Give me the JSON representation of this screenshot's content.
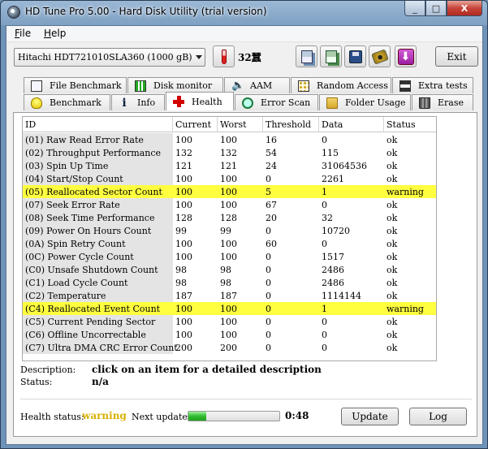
{
  "window": {
    "title": "HD Tune Pro 5.00 - Hard Disk Utility (trial version)",
    "minimize_glyph": "_",
    "maximize_glyph": "□",
    "close_glyph": "X"
  },
  "menu": {
    "items": [
      {
        "label": "File",
        "accel": "F",
        "rest": "ile"
      },
      {
        "label": "Help",
        "accel": "H",
        "rest": "elp"
      }
    ]
  },
  "toolbar": {
    "drive": "Hitachi HDT721010SLA360 (1000 gB)",
    "temperature": "32°C",
    "temperature_display": "32蠶",
    "icons": [
      "copy-text-icon",
      "copy-screenshot-icon",
      "save-icon",
      "options-icon",
      "download-icon"
    ],
    "exit_label": "Exit"
  },
  "tabs": {
    "row1": [
      {
        "label": "File Benchmark",
        "icon": "file-benchmark-icon"
      },
      {
        "label": "Disk monitor",
        "icon": "disk-monitor-icon"
      },
      {
        "label": "AAM",
        "icon": "speaker-icon"
      },
      {
        "label": "Random Access",
        "icon": "random-access-icon"
      },
      {
        "label": "Extra tests",
        "icon": "extra-tests-icon"
      }
    ],
    "row2": [
      {
        "label": "Benchmark",
        "icon": "lightbulb-icon"
      },
      {
        "label": "Info",
        "icon": "info-icon"
      },
      {
        "label": "Health",
        "icon": "health-cross-icon",
        "active": true
      },
      {
        "label": "Error Scan",
        "icon": "magnifier-icon"
      },
      {
        "label": "Folder Usage",
        "icon": "folder-icon"
      },
      {
        "label": "Erase",
        "icon": "trash-icon"
      }
    ]
  },
  "smart_table": {
    "columns": [
      "ID",
      "Current",
      "Worst",
      "Threshold",
      "Data",
      "Status"
    ],
    "rows": [
      {
        "id": "(01) Raw Read Error Rate",
        "current": "100",
        "worst": "100",
        "threshold": "16",
        "data": "0",
        "status": "ok"
      },
      {
        "id": "(02) Throughput Performance",
        "current": "132",
        "worst": "132",
        "threshold": "54",
        "data": "115",
        "status": "ok"
      },
      {
        "id": "(03) Spin Up Time",
        "current": "121",
        "worst": "121",
        "threshold": "24",
        "data": "31064536",
        "status": "ok"
      },
      {
        "id": "(04) Start/Stop Count",
        "current": "100",
        "worst": "100",
        "threshold": "0",
        "data": "2261",
        "status": "ok"
      },
      {
        "id": "(05) Reallocated Sector Count",
        "current": "100",
        "worst": "100",
        "threshold": "5",
        "data": "1",
        "status": "warning"
      },
      {
        "id": "(07) Seek Error Rate",
        "current": "100",
        "worst": "100",
        "threshold": "67",
        "data": "0",
        "status": "ok"
      },
      {
        "id": "(08) Seek Time Performance",
        "current": "128",
        "worst": "128",
        "threshold": "20",
        "data": "32",
        "status": "ok"
      },
      {
        "id": "(09) Power On Hours Count",
        "current": "99",
        "worst": "99",
        "threshold": "0",
        "data": "10720",
        "status": "ok"
      },
      {
        "id": "(0A) Spin Retry Count",
        "current": "100",
        "worst": "100",
        "threshold": "60",
        "data": "0",
        "status": "ok"
      },
      {
        "id": "(0C) Power Cycle Count",
        "current": "100",
        "worst": "100",
        "threshold": "0",
        "data": "1517",
        "status": "ok"
      },
      {
        "id": "(C0) Unsafe Shutdown Count",
        "current": "98",
        "worst": "98",
        "threshold": "0",
        "data": "2486",
        "status": "ok"
      },
      {
        "id": "(C1) Load Cycle Count",
        "current": "98",
        "worst": "98",
        "threshold": "0",
        "data": "2486",
        "status": "ok"
      },
      {
        "id": "(C2) Temperature",
        "current": "187",
        "worst": "187",
        "threshold": "0",
        "data": "1114144",
        "status": "ok"
      },
      {
        "id": "(C4) Reallocated Event Count",
        "current": "100",
        "worst": "100",
        "threshold": "0",
        "data": "1",
        "status": "warning"
      },
      {
        "id": "(C5) Current Pending Sector",
        "current": "100",
        "worst": "100",
        "threshold": "0",
        "data": "0",
        "status": "ok"
      },
      {
        "id": "(C6) Offline Uncorrectable",
        "current": "100",
        "worst": "100",
        "threshold": "0",
        "data": "0",
        "status": "ok"
      },
      {
        "id": "(C7) Ultra DMA CRC Error Count",
        "current": "200",
        "worst": "200",
        "threshold": "0",
        "data": "0",
        "status": "ok"
      }
    ]
  },
  "description": {
    "desc_label": "Description:",
    "desc_value": "click on an item for a detailed description",
    "status_label": "Status:",
    "status_value": "n/a"
  },
  "footer": {
    "health_label": "Health status:",
    "health_value": "warning",
    "next_update_label": "Next update:",
    "progress_fraction": 0.2,
    "time_remaining": "0:48",
    "update_label": "Update",
    "log_label": "Log"
  },
  "colors": {
    "warning_row": "#ffff40",
    "warning_text": "#d8b000",
    "progress": "#2fbb2f"
  }
}
